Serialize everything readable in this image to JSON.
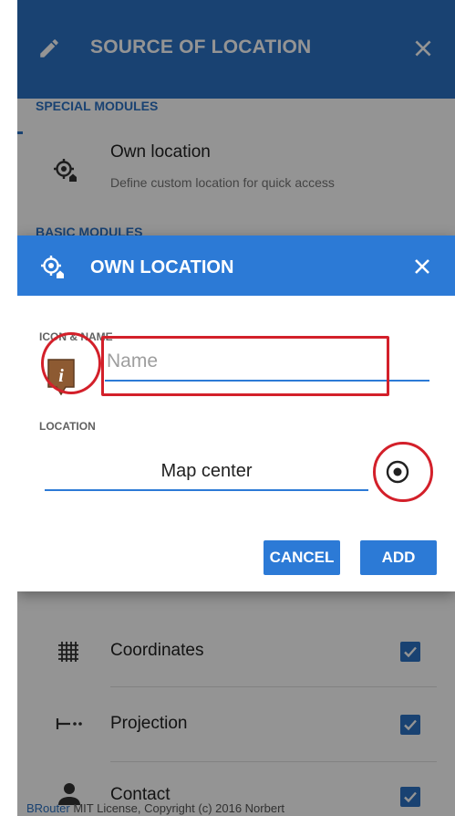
{
  "panel": {
    "title": "SOURCE OF LOCATION",
    "special_modules_label": "SPECIAL MODULES",
    "own_location_title": "Own location",
    "own_location_desc": "Define custom location for quick access",
    "basic_modules_label": "BASIC MODULES",
    "items": [
      {
        "label": "Coordinates",
        "icon": "grid-icon",
        "checked": true
      },
      {
        "label": "Projection",
        "icon": "projection-icon",
        "checked": true
      },
      {
        "label": "Contact",
        "icon": "person-icon",
        "checked": true
      }
    ]
  },
  "dialog": {
    "title": "OWN LOCATION",
    "icon_name_label": "ICON & NAME",
    "name_placeholder": "Name",
    "location_label": "LOCATION",
    "location_value": "Map center",
    "cancel_label": "CANCEL",
    "add_label": "ADD"
  },
  "footer": {
    "brand": "BRouter",
    "text": "MIT License, Copyright (c) 2016 Norbert"
  },
  "colors": {
    "header_blue": "#2c72c4",
    "dialog_blue": "#2c7ad6",
    "highlight_red": "#d3202a",
    "poi_brown": "#8d5a32"
  }
}
